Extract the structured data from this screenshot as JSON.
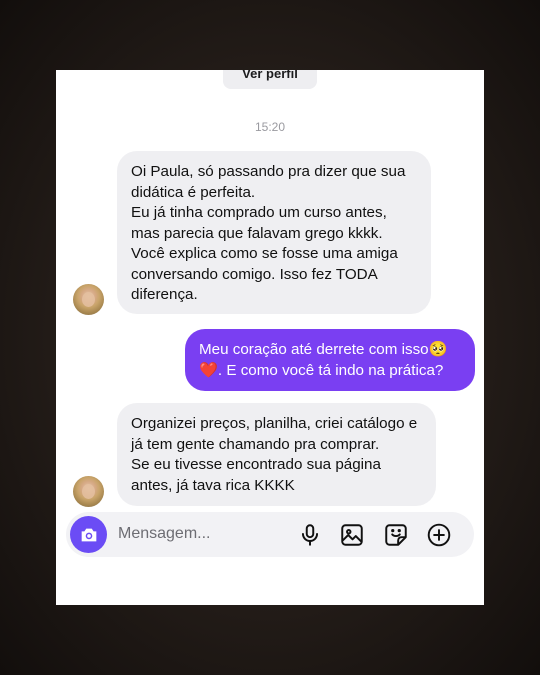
{
  "header": {
    "profile_button": "Ver perfil"
  },
  "timestamp": "15:20",
  "messages": [
    {
      "from": "other",
      "lines": [
        "Oi Paula, só passando pra dizer que sua didática é perfeita.",
        "Eu já tinha comprado um curso antes, mas parecia que falavam grego kkkk.",
        "Você explica como se fosse uma amiga conversando comigo. Isso fez TODA diferença."
      ]
    },
    {
      "from": "me",
      "text_part1": "Meu coração até derrete com isso🥺",
      "text_heart": "❤️",
      "text_part2": ". E como você tá indo na prática?"
    },
    {
      "from": "other",
      "lines": [
        "Organizei preços, planilha, criei catálogo e já tem gente chamando pra comprar.",
        "Se eu tivesse encontrado sua página antes, já tava rica KKKK"
      ]
    }
  ],
  "composer": {
    "placeholder": "Mensagem...",
    "icons": [
      "camera-icon",
      "microphone-icon",
      "gallery-icon",
      "sticker-icon",
      "plus-icon"
    ]
  },
  "colors": {
    "outgoing_bubble": "#7a3ff2",
    "incoming_bubble": "#efeff2",
    "camera_button": "#6b4cf5",
    "heart": "#e0245e"
  }
}
